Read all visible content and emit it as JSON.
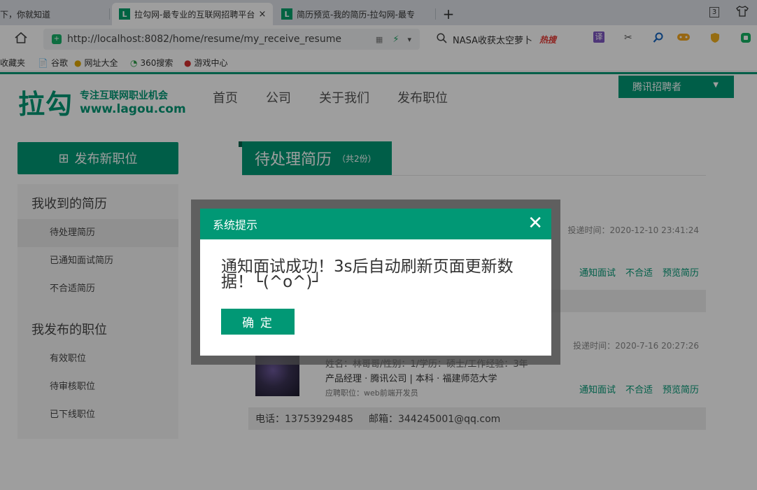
{
  "browser": {
    "tabs": [
      {
        "title": "下，你就知道"
      },
      {
        "title": "拉勾网-最专业的互联网招聘平台",
        "favicon": "L",
        "close": "×"
      },
      {
        "title": "简历预览-我的简历-拉勾网-最专",
        "favicon": "L"
      }
    ],
    "new_tab": "+",
    "tab_count": "3",
    "url": "http://localhost:8082/home/resume/my_receive_resume",
    "search_text": "NASA收获太空萝卜",
    "search_badge": "热搜",
    "translate": "译",
    "bookmarks": [
      "收藏夹",
      "谷歌",
      "网址大全",
      "360搜索",
      "游戏中心"
    ]
  },
  "site": {
    "logo_mark": "拉勾",
    "logo_slogan": "专注互联网职业机会",
    "logo_url": "www.lagou.com",
    "nav": [
      "首页",
      "公司",
      "关于我们",
      "发布职位"
    ],
    "account": "腾讯招聘者",
    "post_button": "发布新职位",
    "sidebar": {
      "received_title": "我收到的简历",
      "received_items": [
        "待处理简历",
        "已通知面试简历",
        "不合适简历"
      ],
      "posted_title": "我发布的职位",
      "posted_items": [
        "有效职位",
        "待审核职位",
        "已下线职位"
      ]
    },
    "heading": "待处理简历",
    "heading_count": "（共2份）"
  },
  "resumes": [
    {
      "time": "投递时间：2020-12-10 23:41:24",
      "actions": [
        "通知面试",
        "不合适",
        "预览简历"
      ]
    },
    {
      "time": "投递时间：2020-7-16 20:27:26",
      "info": "姓名：林哥哥/性别：1/学历：硕士/工作经验：3年",
      "main": "产品经理 · 腾讯公司 | 本科 · 福建师范大学",
      "job": "应聘职位：web前端开发员",
      "actions": [
        "通知面试",
        "不合适",
        "预览简历"
      ],
      "phone": "电话：13753929485",
      "email": "邮箱：344245001@qq.com"
    }
  ],
  "modal": {
    "title": "系统提示",
    "message": "通知面试成功！3s后自动刷新页面更新数据！└(^o^)┘",
    "confirm": "确 定"
  }
}
